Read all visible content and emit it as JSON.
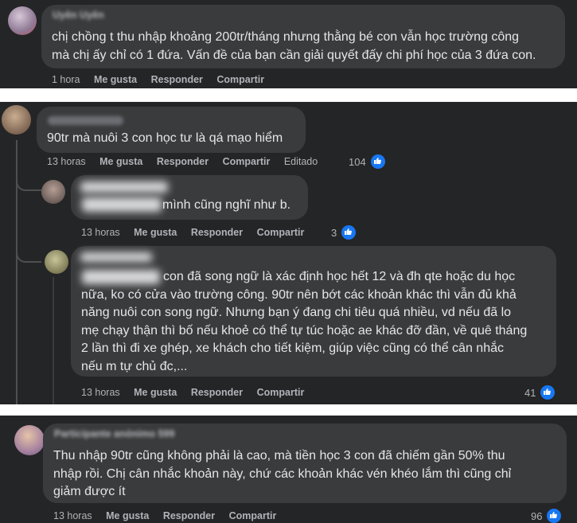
{
  "comments": [
    {
      "name": "Uyên Uyên",
      "text": "chị chồng t thu nhập khoảng 200tr/tháng nhưng thằng bé con vẫn học trường công\nmà chị ấy chỉ có 1 đứa. Vấn đề của bạn cần giải quyết đấy chi phí học của 3 đứa con.",
      "time": "1 hora",
      "like": "Me gusta",
      "reply": "Responder",
      "share": "Compartir"
    },
    {
      "text": "90tr mà nuôi 3 con học tư là qá mạo hiểm",
      "time": "13 horas",
      "like": "Me gusta",
      "reply": "Responder",
      "share": "Compartir",
      "edited": "Editado",
      "reactions": "104"
    },
    {
      "text": "mình cũng nghĩ như b.",
      "time": "13 horas",
      "like": "Me gusta",
      "reply": "Responder",
      "share": "Compartir",
      "reactions": "3"
    },
    {
      "text_first": "con đã song ngữ là xác định học hết 12 và đh qte hoặc du học",
      "text_rest": "nữa, ko có cửa vào trường công. 90tr nên bớt các khoản khác thì vẫn đủ khả\nnăng nuôi con song ngữ. Nhưng bạn ý đang chi tiêu quá nhiều, vd nếu đã lo\nmẹ chạy thận thì bố nếu khoẻ có thể tự túc hoặc ae khác đỡ đần, về quê tháng\n2 lần thì đi xe ghép, xe khách cho tiết kiệm, giúp việc cũng có thể cân nhắc\nnếu m tự chủ đc,...",
      "time": "13 horas",
      "like": "Me gusta",
      "reply": "Responder",
      "share": "Compartir",
      "reactions": "41"
    },
    {
      "name": "Participante anónimo 599",
      "text": "Thu nhập 90tr cũng không phải là cao, mà tiền học 3 con đã chiếm gần 50% thu\nnhập rồi. Chị cân nhắc khoản này, chứ các khoản khác vén khéo lắm thì cũng chỉ\ngiảm được ít",
      "time": "13 horas",
      "like": "Me gusta",
      "reply": "Responder",
      "share": "Compartir",
      "reactions": "96"
    }
  ],
  "colors": {
    "background": "#242526",
    "bubble": "#3a3b3c",
    "text": "#e4e6eb",
    "muted": "#b0b3b8",
    "like_badge": "#1877f2"
  },
  "icons": [
    "like-icon"
  ]
}
